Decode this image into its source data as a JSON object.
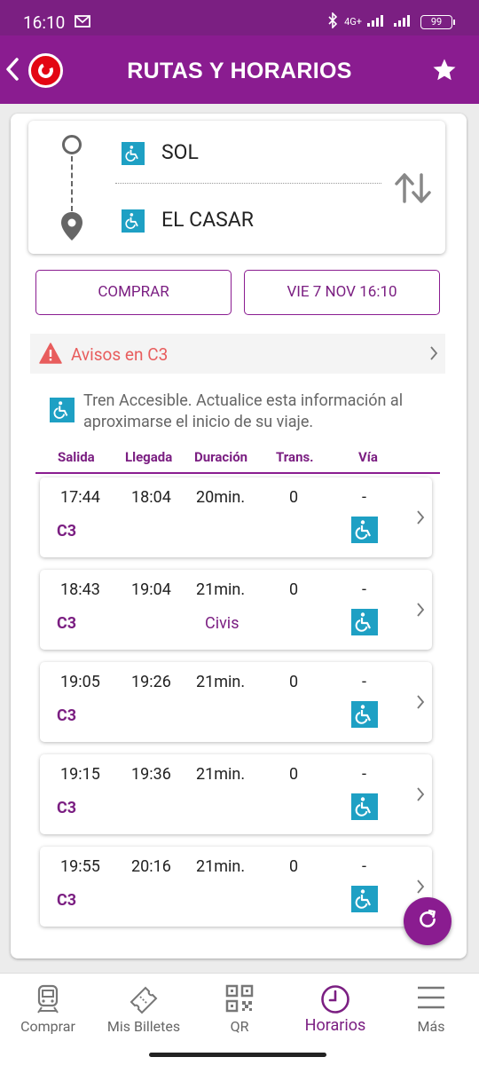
{
  "status": {
    "time": "16:10",
    "network": "4G+",
    "battery": "99"
  },
  "header": {
    "title": "RUTAS Y HORARIOS",
    "back_icon": "chevron-left-icon",
    "favorite_icon": "star-icon"
  },
  "route": {
    "origin": "SOL",
    "destination": "EL CASAR"
  },
  "actions": {
    "buy_label": "COMPRAR",
    "date_label": "VIE 7 NOV 16:10"
  },
  "alert": {
    "text": "Avisos en C3"
  },
  "info": {
    "text": "Tren Accesible. Actualice esta información al aproximarse el inicio de su viaje."
  },
  "columns": [
    "Salida",
    "Llegada",
    "Duración",
    "Trans.",
    "Vía"
  ],
  "trips": [
    {
      "departure": "17:44",
      "arrival": "18:04",
      "duration": "20min.",
      "transfers": "0",
      "platform": "-",
      "line": "C3",
      "model": ""
    },
    {
      "departure": "18:43",
      "arrival": "19:04",
      "duration": "21min.",
      "transfers": "0",
      "platform": "-",
      "line": "C3",
      "model": "Civis"
    },
    {
      "departure": "19:05",
      "arrival": "19:26",
      "duration": "21min.",
      "transfers": "0",
      "platform": "-",
      "line": "C3",
      "model": ""
    },
    {
      "departure": "19:15",
      "arrival": "19:36",
      "duration": "21min.",
      "transfers": "0",
      "platform": "-",
      "line": "C3",
      "model": ""
    },
    {
      "departure": "19:55",
      "arrival": "20:16",
      "duration": "21min.",
      "transfers": "0",
      "platform": "-",
      "line": "C3",
      "model": ""
    }
  ],
  "tabs": [
    {
      "label": "Comprar",
      "icon": "train-icon"
    },
    {
      "label": "Mis Billetes",
      "icon": "ticket-icon"
    },
    {
      "label": "QR",
      "icon": "qr-code-icon"
    },
    {
      "label": "Horarios",
      "icon": "clock-icon",
      "active": true
    },
    {
      "label": "Más",
      "icon": "menu-icon"
    }
  ],
  "colors": {
    "brand": "#8a1c90",
    "accessible": "#1ea0c4",
    "alert": "#e85d5d"
  }
}
